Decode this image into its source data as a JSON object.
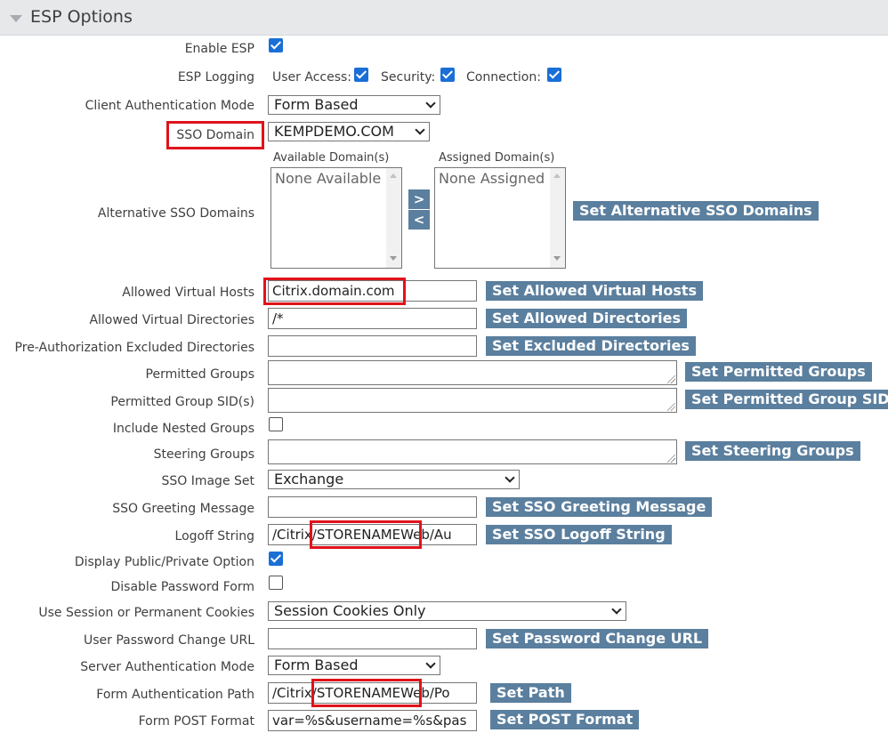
{
  "section": {
    "title": "ESP Options"
  },
  "labels": {
    "enable_esp": "Enable ESP",
    "esp_logging": "ESP Logging",
    "client_auth_mode": "Client Authentication Mode",
    "sso_domain": "SSO Domain",
    "alt_sso_domains": "Alternative SSO Domains",
    "allowed_virtual_hosts": "Allowed Virtual Hosts",
    "allowed_virtual_directories": "Allowed Virtual Directories",
    "preauth_excluded_dirs": "Pre-Authorization Excluded Directories",
    "permitted_groups": "Permitted Groups",
    "permitted_group_sids": "Permitted Group SID(s)",
    "include_nested_groups": "Include Nested Groups",
    "steering_groups": "Steering Groups",
    "sso_image_set": "SSO Image Set",
    "sso_greeting_message": "SSO Greeting Message",
    "logoff_string": "Logoff String",
    "display_public_private": "Display Public/Private Option",
    "disable_password_form": "Disable Password Form",
    "session_or_permanent_cookies": "Use Session or Permanent Cookies",
    "user_password_change_url": "User Password Change URL",
    "server_auth_mode": "Server Authentication Mode",
    "form_auth_path": "Form Authentication Path",
    "form_post_format": "Form POST Format"
  },
  "logging": {
    "user_access": "User Access:",
    "security": "Security:",
    "connection": "Connection:"
  },
  "checkboxes": {
    "enable_esp": true,
    "user_access": true,
    "security": true,
    "connection": true,
    "include_nested_groups": false,
    "display_public_private": true,
    "disable_password_form": false
  },
  "selects": {
    "client_auth_mode": "Form Based",
    "sso_domain": "KEMPDEMO.COM",
    "sso_image_set": "Exchange",
    "cookies": "Session Cookies Only",
    "server_auth_mode": "Form Based"
  },
  "alt_domains": {
    "available_header": "Available Domain(s)",
    "assigned_header": "Assigned Domain(s)",
    "available_item": "None Available",
    "assigned_item": "None Assigned",
    "move_right": ">",
    "move_left": "<"
  },
  "inputs": {
    "allowed_virtual_hosts": "Citrix.domain.com",
    "allowed_virtual_directories": "/*",
    "preauth_excluded_dirs": "",
    "sso_greeting_message": "",
    "logoff_string": "/Citrix/STORENAMEWeb/Au",
    "user_password_change_url": "",
    "form_auth_path": "/Citrix/STORENAMEWeb/Po",
    "form_post_format": "var=%s&username=%s&pas"
  },
  "buttons": {
    "set_alt_sso_domains": "Set Alternative SSO Domains",
    "set_allowed_virtual_hosts": "Set Allowed Virtual Hosts",
    "set_allowed_directories": "Set Allowed Directories",
    "set_excluded_directories": "Set Excluded Directories",
    "set_permitted_groups": "Set Permitted Groups",
    "set_permitted_group_sids": "Set Permitted Group SIDs",
    "set_steering_groups": "Set Steering Groups",
    "set_sso_greeting_message": "Set SSO Greeting Message",
    "set_sso_logoff_string": "Set SSO Logoff String",
    "set_password_change_url": "Set Password Change URL",
    "set_path": "Set Path",
    "set_post_format": "Set POST Format"
  },
  "colors": {
    "button_bg": "#5b7f9e",
    "checkbox_checked": "#1a6fd6",
    "highlight": "#e0121b",
    "header_bg": "#e6e8ea"
  }
}
